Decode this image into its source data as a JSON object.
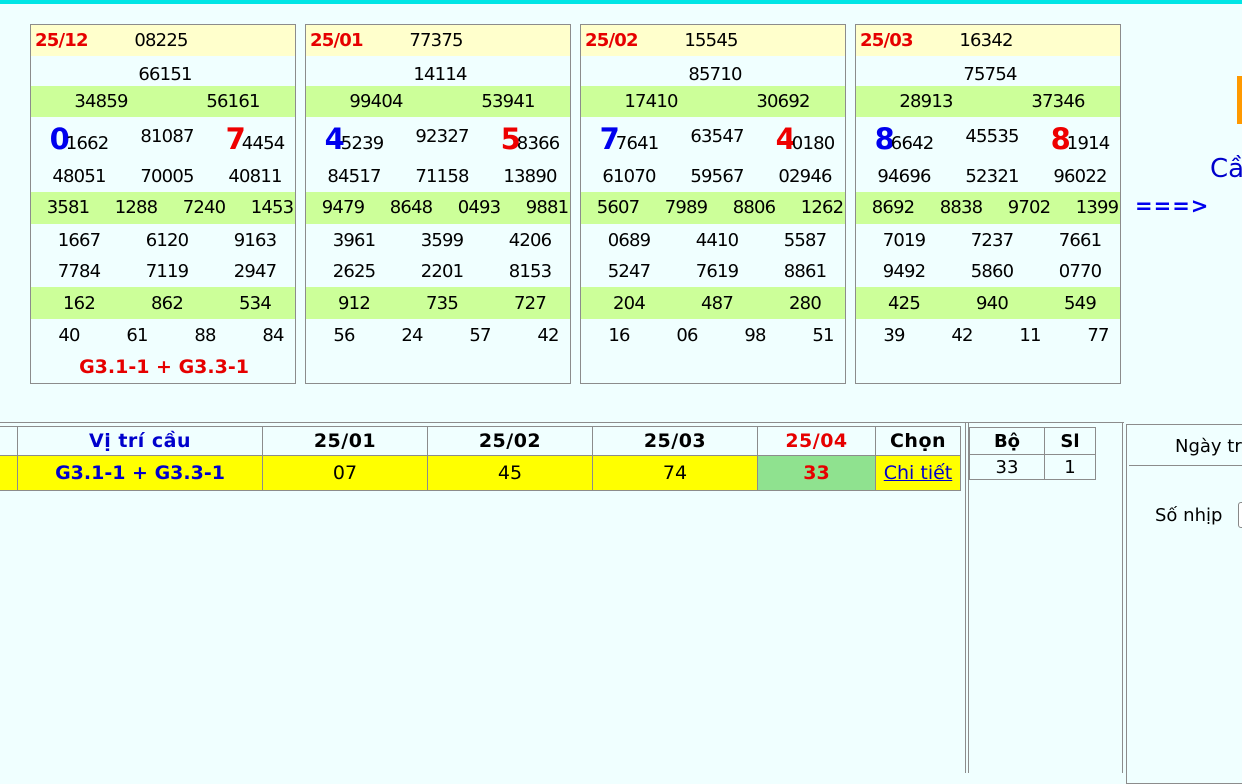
{
  "cards": [
    {
      "date": "25/12",
      "db": "08225",
      "g1": "66151",
      "g2": [
        "34859",
        "56161"
      ],
      "g3": [
        {
          "lead": "0",
          "lead_color": "blue",
          "rest": "1662"
        },
        {
          "lead": "",
          "lead_color": "",
          "rest": "81087"
        },
        {
          "lead": "7",
          "lead_color": "red",
          "rest": "4454"
        }
      ],
      "g3b": [
        "48051",
        "70005",
        "40811"
      ],
      "g4": [
        "3581",
        "1288",
        "7240",
        "1453"
      ],
      "g5a": [
        "1667",
        "6120",
        "9163"
      ],
      "g5b": [
        "7784",
        "7119",
        "2947"
      ],
      "g6": [
        "162",
        "862",
        "534"
      ],
      "g7": [
        "40",
        "61",
        "88",
        "84"
      ],
      "label": "G3.1-1 + G3.3-1"
    },
    {
      "date": "25/01",
      "db": "77375",
      "g1": "14114",
      "g2": [
        "99404",
        "53941"
      ],
      "g3": [
        {
          "lead": "4",
          "lead_color": "blue",
          "rest": "5239"
        },
        {
          "lead": "",
          "lead_color": "",
          "rest": "92327"
        },
        {
          "lead": "5",
          "lead_color": "red",
          "rest": "8366"
        }
      ],
      "g3b": [
        "84517",
        "71158",
        "13890"
      ],
      "g4": [
        "9479",
        "8648",
        "0493",
        "9881"
      ],
      "g5a": [
        "3961",
        "3599",
        "4206"
      ],
      "g5b": [
        "2625",
        "2201",
        "8153"
      ],
      "g6": [
        "912",
        "735",
        "727"
      ],
      "g7": [
        "56",
        "24",
        "57",
        "42"
      ],
      "label": ""
    },
    {
      "date": "25/02",
      "db": "15545",
      "g1": "85710",
      "g2": [
        "17410",
        "30692"
      ],
      "g3": [
        {
          "lead": "7",
          "lead_color": "blue",
          "rest": "7641"
        },
        {
          "lead": "",
          "lead_color": "",
          "rest": "63547"
        },
        {
          "lead": "4",
          "lead_color": "red",
          "rest": "0180"
        }
      ],
      "g3b": [
        "61070",
        "59567",
        "02946"
      ],
      "g4": [
        "5607",
        "7989",
        "8806",
        "1262"
      ],
      "g5a": [
        "0689",
        "4410",
        "5587"
      ],
      "g5b": [
        "5247",
        "7619",
        "8861"
      ],
      "g6": [
        "204",
        "487",
        "280"
      ],
      "g7": [
        "16",
        "06",
        "98",
        "51"
      ],
      "label": ""
    },
    {
      "date": "25/03",
      "db": "16342",
      "g1": "75754",
      "g2": [
        "28913",
        "37346"
      ],
      "g3": [
        {
          "lead": "8",
          "lead_color": "blue",
          "rest": "6642"
        },
        {
          "lead": "",
          "lead_color": "",
          "rest": "45535"
        },
        {
          "lead": "8",
          "lead_color": "red",
          "rest": "1914"
        }
      ],
      "g3b": [
        "94696",
        "52321",
        "96022"
      ],
      "g4": [
        "8692",
        "8838",
        "9702",
        "1399"
      ],
      "g5a": [
        "7019",
        "7237",
        "7661"
      ],
      "g5b": [
        "9492",
        "5860",
        "0770"
      ],
      "g6": [
        "425",
        "940",
        "549"
      ],
      "g7": [
        "39",
        "42",
        "11",
        "77"
      ],
      "label": ""
    }
  ],
  "arrow": "===>",
  "cau_partial": "Cầ",
  "table": {
    "headers": [
      "Vị trí cầu",
      "25/01",
      "25/02",
      "25/03",
      "25/04",
      "Chọn"
    ],
    "row": {
      "vitri": "G3.1-1 + G3.3-1",
      "v1": "07",
      "v2": "45",
      "v3": "74",
      "v4": "33",
      "link": "Chi tiết"
    }
  },
  "bo_table": {
    "headers": [
      "Bộ",
      "Sl"
    ],
    "row": [
      "33",
      "1"
    ]
  },
  "right_panel": {
    "ngay_partial": "Ngày tra",
    "sonhip": "Số nhịp"
  },
  "colors": {
    "blue": "#0000ee",
    "red": "#ee0000",
    "yellow": "#ffff00",
    "lightgreen": "#ccff99",
    "green": "#8fe28f",
    "cream": "#ffffcc"
  }
}
